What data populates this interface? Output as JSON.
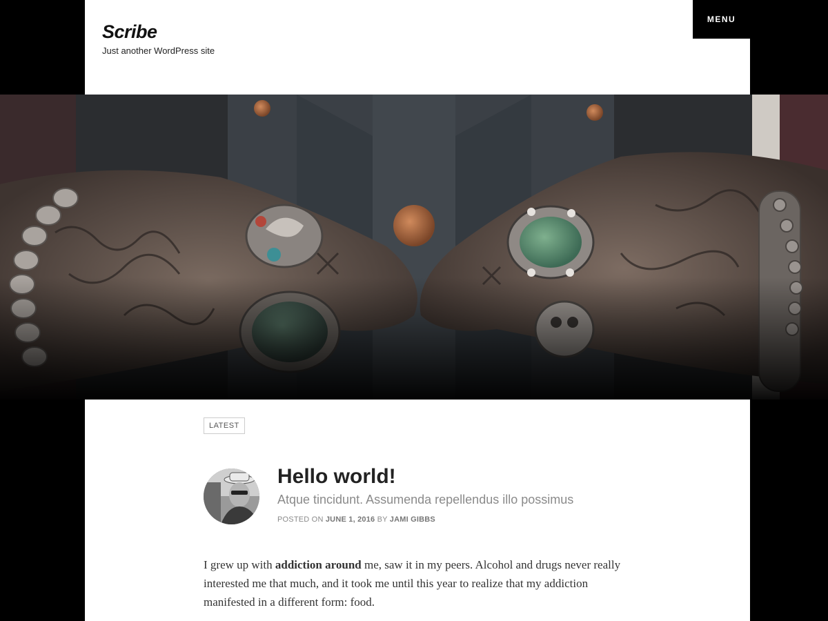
{
  "header": {
    "site_title": "Scribe",
    "tagline": "Just another WordPress site",
    "menu_label": "MENU"
  },
  "hero": {
    "image": "hands-with-tattoos-and-rings"
  },
  "post": {
    "category": "LATEST",
    "title": "Hello world!",
    "subtitle": "Atque tincidunt. Assumenda repellendus illo possimus",
    "meta": {
      "posted_on_label": "POSTED ON",
      "date": "JUNE 1, 2016",
      "by_label": "BY",
      "author": "JAMI GIBBS"
    },
    "body": {
      "intro": "I grew up with ",
      "bold": "addiction around",
      "rest": " me, saw it in my peers. Alcohol and drugs never really interested me that much, and it took me until this year to realize that my addiction manifested in a different form: food."
    }
  },
  "colors": {
    "background": "#000000",
    "panel": "#ffffff",
    "text": "#222222",
    "muted": "#8a8a8a"
  }
}
